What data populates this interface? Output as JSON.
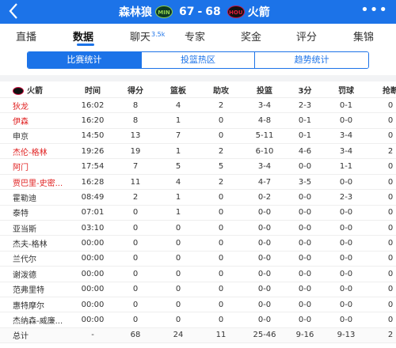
{
  "header": {
    "back_icon": "chevron-left-icon",
    "home_team": "森林狼",
    "home_logo": "MIN",
    "home_score": "67",
    "separator": "-",
    "away_score": "68",
    "away_logo": "HOU",
    "away_team": "火箭",
    "more_icon": "ellipsis-icon"
  },
  "main_tabs": [
    {
      "label": "直播"
    },
    {
      "label": "数据",
      "active": true
    },
    {
      "label": "聊天",
      "badge": "3.5k"
    },
    {
      "label": "专家"
    },
    {
      "label": "奖金"
    },
    {
      "label": "评分"
    },
    {
      "label": "集锦"
    }
  ],
  "segments": [
    "比赛统计",
    "投篮热区",
    "趋势统计"
  ],
  "table": {
    "team_label": "火箭",
    "columns": [
      "时间",
      "得分",
      "篮板",
      "助攻",
      "投篮",
      "3分",
      "罚球",
      "抢断"
    ],
    "rows": [
      {
        "name": "狄龙",
        "starter": true,
        "cells": [
          "16:02",
          "8",
          "4",
          "2",
          "3-4",
          "2-3",
          "0-1",
          "0"
        ]
      },
      {
        "name": "伊森",
        "starter": true,
        "cells": [
          "16:20",
          "8",
          "1",
          "0",
          "4-8",
          "0-1",
          "0-0",
          "0"
        ]
      },
      {
        "name": "申京",
        "starter": false,
        "cells": [
          "14:50",
          "13",
          "7",
          "0",
          "5-11",
          "0-1",
          "3-4",
          "0"
        ]
      },
      {
        "name": "杰伦-格林",
        "starter": true,
        "cells": [
          "19:26",
          "19",
          "1",
          "2",
          "6-10",
          "4-6",
          "3-4",
          "2"
        ]
      },
      {
        "name": "阿门",
        "starter": true,
        "cells": [
          "17:54",
          "7",
          "5",
          "5",
          "3-4",
          "0-0",
          "1-1",
          "0"
        ]
      },
      {
        "name": "贾巴里-史密...",
        "starter": true,
        "cells": [
          "16:28",
          "11",
          "4",
          "2",
          "4-7",
          "3-5",
          "0-0",
          "0"
        ]
      },
      {
        "name": "霍勒迪",
        "starter": false,
        "cells": [
          "08:49",
          "2",
          "1",
          "0",
          "0-2",
          "0-0",
          "2-3",
          "0"
        ]
      },
      {
        "name": "泰特",
        "starter": false,
        "cells": [
          "07:01",
          "0",
          "1",
          "0",
          "0-0",
          "0-0",
          "0-0",
          "0"
        ]
      },
      {
        "name": "亚当斯",
        "starter": false,
        "cells": [
          "03:10",
          "0",
          "0",
          "0",
          "0-0",
          "0-0",
          "0-0",
          "0"
        ]
      },
      {
        "name": "杰夫-格林",
        "starter": false,
        "cells": [
          "00:00",
          "0",
          "0",
          "0",
          "0-0",
          "0-0",
          "0-0",
          "0"
        ]
      },
      {
        "name": "兰代尔",
        "starter": false,
        "cells": [
          "00:00",
          "0",
          "0",
          "0",
          "0-0",
          "0-0",
          "0-0",
          "0"
        ]
      },
      {
        "name": "谢泼德",
        "starter": false,
        "cells": [
          "00:00",
          "0",
          "0",
          "0",
          "0-0",
          "0-0",
          "0-0",
          "0"
        ]
      },
      {
        "name": "范弗里特",
        "starter": false,
        "cells": [
          "00:00",
          "0",
          "0",
          "0",
          "0-0",
          "0-0",
          "0-0",
          "0"
        ]
      },
      {
        "name": "惠特摩尔",
        "starter": false,
        "cells": [
          "00:00",
          "0",
          "0",
          "0",
          "0-0",
          "0-0",
          "0-0",
          "0"
        ]
      },
      {
        "name": "杰纳森-威廉...",
        "starter": false,
        "cells": [
          "00:00",
          "0",
          "0",
          "0",
          "0-0",
          "0-0",
          "0-0",
          "0"
        ]
      }
    ],
    "total": {
      "name": "总计",
      "cells": [
        "-",
        "68",
        "24",
        "11",
        "25-46",
        "9-16",
        "9-13",
        "2"
      ]
    }
  },
  "colors": {
    "accent": "#1c73e8",
    "starter_name": "#e02020"
  }
}
